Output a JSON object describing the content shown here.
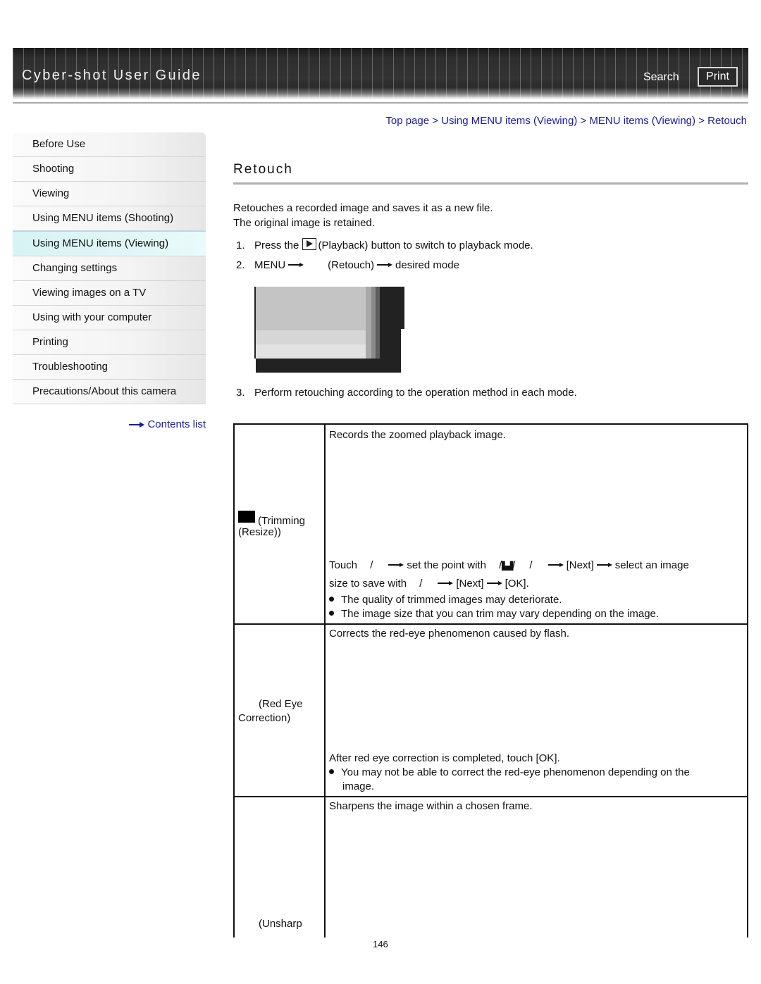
{
  "header": {
    "title": "Cyber-shot User Guide",
    "search_label": "Search",
    "print_label": "Print"
  },
  "breadcrumb": {
    "items": [
      "Top page",
      "Using MENU items (Viewing)",
      "MENU items (Viewing)",
      "Retouch"
    ],
    "separator": ">"
  },
  "sidebar": {
    "items": [
      {
        "label": "Before Use"
      },
      {
        "label": "Shooting"
      },
      {
        "label": "Viewing"
      },
      {
        "label": "Using MENU items (Shooting)"
      },
      {
        "label": "Using MENU items (Viewing)",
        "active": true
      },
      {
        "label": "Changing settings"
      },
      {
        "label": "Viewing images on a TV"
      },
      {
        "label": "Using with your computer"
      },
      {
        "label": "Printing"
      },
      {
        "label": "Troubleshooting"
      },
      {
        "label": "Precautions/About this camera"
      }
    ],
    "contents_link": "Contents list"
  },
  "main": {
    "title": "Retouch",
    "intro": [
      "Retouches a recorded image and saves it as a new file.",
      "The original image is retained."
    ],
    "steps": [
      {
        "num": "1.",
        "pre": "Press the",
        "icon": "playback-icon",
        "post": "(Playback) button to switch to playback mode."
      },
      {
        "num": "2.",
        "parts": [
          "MENU",
          "(Retouch)",
          "desired mode"
        ]
      },
      {
        "num": "3.",
        "text": "Perform retouching according to the operation method in each mode."
      }
    ],
    "table": {
      "rows": [
        {
          "name_line1": "(Trimming",
          "name_line2": "(Resize))",
          "desc": "Records the zoomed playback image.",
          "instr_line1": [
            "Touch",
            "/",
            "set the point with",
            "/",
            "/",
            "/",
            "[Next]",
            "select an image"
          ],
          "instr_line2": [
            "size to save with",
            "/",
            "[Next]",
            "[OK]."
          ],
          "notes": [
            "The quality of trimmed images may deteriorate.",
            "The image size that you can trim may vary depending on the image."
          ]
        },
        {
          "name_line1": "(Red Eye",
          "name_line2": "Correction)",
          "desc": "Corrects the red-eye phenomenon caused by flash.",
          "instr": "After red eye correction is completed, touch [OK].",
          "notes_line1": "You may not be able to correct the red-eye phenomenon depending on the",
          "notes_line2": "image."
        },
        {
          "name_line1": "(Unsharp",
          "desc": "Sharpens the image within a chosen frame."
        }
      ]
    }
  },
  "footer": {
    "page_number": "146"
  }
}
